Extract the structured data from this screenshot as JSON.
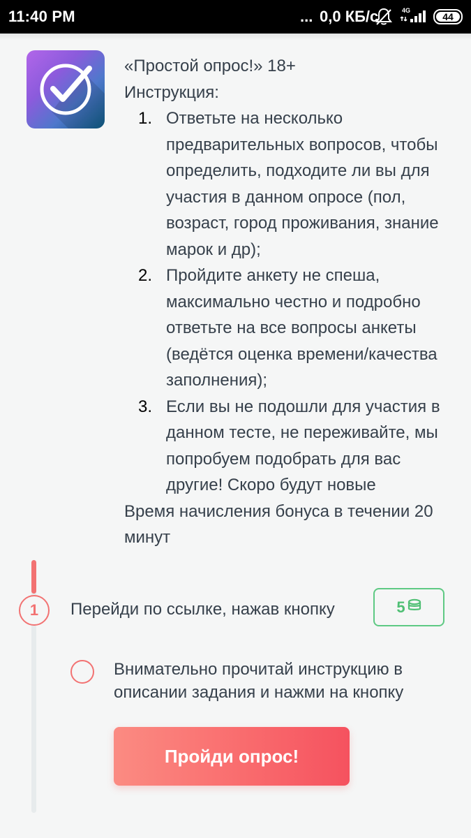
{
  "status_bar": {
    "time": "11:40 PM",
    "dots": "...",
    "speed": "0,0 КБ/с",
    "network": "4G",
    "battery": "44",
    "icons": [
      "bell-off-icon",
      "signal-icon",
      "battery-icon"
    ]
  },
  "app": {
    "icon": "checkmark-circle-icon",
    "title": "«Простой опрос!» 18+",
    "subtitle": "Инструкция:",
    "steps": [
      {
        "num": "1.",
        "text": "Ответьте на несколько предварительных вопросов, чтобы определить, подходите ли вы для участия в данном опросе (пол, возраст, город проживания, знание марок и др);"
      },
      {
        "num": "2.",
        "text": "Пройдите анкету не спеша, максимально честно и подробно ответьте на все вопросы анкеты (ведётся оценка времени/качества заполнения);"
      },
      {
        "num": "3.",
        "text": "Если вы не подошли для участия в данном тесте, не переживайте, мы попробуем подобрать для вас другие! Скоро будут новые"
      }
    ],
    "footer": "Время начисления бонуса в течении 20 минут"
  },
  "task": {
    "step_number": "1",
    "label": "Перейди по ссылке, нажав кнопку",
    "reward": "5",
    "reward_icon": "coins-icon",
    "subtask": "Внимательно прочитай инструкцию в описании задания и нажми на кнопку",
    "button": "Пройди опрос!"
  },
  "colors": {
    "accent": "#f27272",
    "reward": "#4fbf74",
    "text": "#36404b",
    "background": "#f5f6f6"
  }
}
